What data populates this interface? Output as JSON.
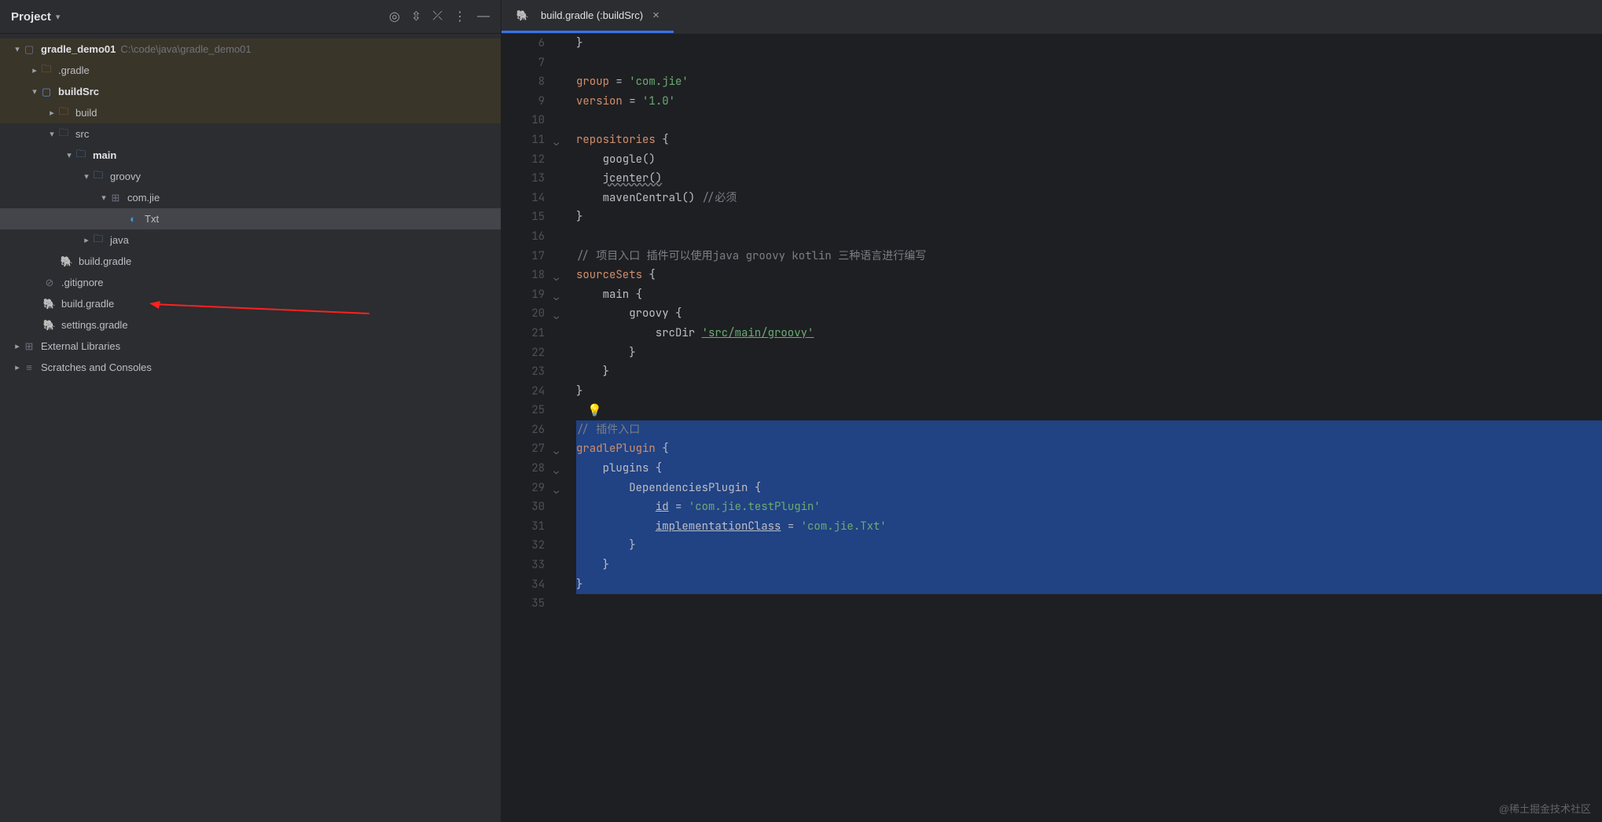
{
  "sidebar": {
    "title": "Project",
    "tree": {
      "root_name": "gradle_demo01",
      "root_path": "C:\\code\\java\\gradle_demo01",
      "gradle_dir": ".gradle",
      "buildSrc": "buildSrc",
      "build": "build",
      "src": "src",
      "main": "main",
      "groovy": "groovy",
      "pkg": "com.jie",
      "txt": "Txt",
      "java": "java",
      "build_gradle_inner": "build.gradle",
      "gitignore": ".gitignore",
      "build_gradle_root": "build.gradle",
      "settings_gradle": "settings.gradle",
      "ext_libs": "External Libraries",
      "scratches": "Scratches and Consoles"
    }
  },
  "tab": {
    "icon": "gradle",
    "label": "build.gradle (:buildSrc)"
  },
  "code": {
    "lines": [
      {
        "n": 6,
        "html": "}"
      },
      {
        "n": 7,
        "html": ""
      },
      {
        "n": 8,
        "html": "<span class='k-key'>group</span> = <span class='k-str'>'com.jie'</span>"
      },
      {
        "n": 9,
        "html": "<span class='k-key'>version</span> = <span class='k-str'>'1.0'</span>"
      },
      {
        "n": 10,
        "html": ""
      },
      {
        "n": 11,
        "fold": true,
        "html": "<span class='k-key'>repositories</span> {"
      },
      {
        "n": 12,
        "html": "    google()"
      },
      {
        "n": 13,
        "html": "    <span class='k-warn'>jcenter()</span>"
      },
      {
        "n": 14,
        "html": "    mavenCentral() <span class='k-cmt'>//必须</span>"
      },
      {
        "n": 15,
        "html": "}"
      },
      {
        "n": 16,
        "html": ""
      },
      {
        "n": 17,
        "html": "<span class='k-cmt'>// 项目入口 插件可以使用java groovy kotlin 三种语言进行编写</span>"
      },
      {
        "n": 18,
        "fold": true,
        "html": "<span class='k-key'>sourceSets</span> {"
      },
      {
        "n": 19,
        "fold": true,
        "html": "    main {"
      },
      {
        "n": 20,
        "fold": true,
        "html": "        groovy {"
      },
      {
        "n": 21,
        "html": "            srcDir <span class='k-link'>'src/main/groovy'</span>"
      },
      {
        "n": 22,
        "html": "        }"
      },
      {
        "n": 23,
        "html": "    }"
      },
      {
        "n": 24,
        "html": "}"
      },
      {
        "n": 25,
        "bulb": true,
        "html": ""
      },
      {
        "n": 26,
        "sel": true,
        "html": "<span class='k-cmt'>// 插件入口</span>"
      },
      {
        "n": 27,
        "sel": true,
        "fold": true,
        "html": "<span class='k-key'>gradlePlugin</span> {"
      },
      {
        "n": 28,
        "sel": true,
        "fold": true,
        "html": "    plugins {"
      },
      {
        "n": 29,
        "sel": true,
        "fold": true,
        "html": "        DependenciesPlugin {"
      },
      {
        "n": 30,
        "sel": true,
        "html": "            <span class='k-under'>id</span> = <span class='k-str'>'com.jie.testPlugin'</span>"
      },
      {
        "n": 31,
        "sel": true,
        "html": "            <span class='k-under'>implementationClass</span> = <span class='k-str'>'com.jie.Txt'</span>"
      },
      {
        "n": 32,
        "sel": true,
        "html": "        }"
      },
      {
        "n": 33,
        "sel": true,
        "html": "    }"
      },
      {
        "n": 34,
        "sel": true,
        "html": "}"
      },
      {
        "n": 35,
        "html": ""
      }
    ]
  },
  "watermark": "@稀土掘金技术社区"
}
